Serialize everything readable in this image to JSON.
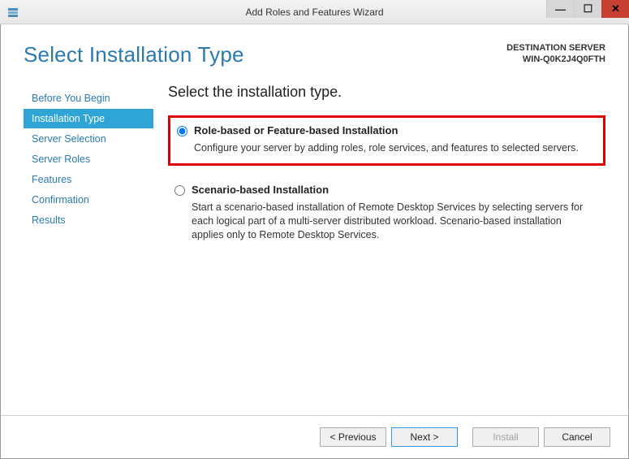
{
  "title": "Add Roles and Features Wizard",
  "destination": {
    "label": "DESTINATION SERVER",
    "name": "WIN-Q0K2J4Q0FTH"
  },
  "page_heading": "Select Installation Type",
  "main_heading": "Select the installation type.",
  "sidebar": {
    "items": [
      {
        "label": "Before You Begin"
      },
      {
        "label": "Installation Type"
      },
      {
        "label": "Server Selection"
      },
      {
        "label": "Server Roles"
      },
      {
        "label": "Features"
      },
      {
        "label": "Confirmation"
      },
      {
        "label": "Results"
      }
    ]
  },
  "options": {
    "role_based": {
      "label": "Role-based or Feature-based Installation",
      "desc": "Configure your server by adding roles, role services, and features to selected servers."
    },
    "scenario_based": {
      "label": "Scenario-based Installation",
      "desc": "Start a scenario-based installation of Remote Desktop Services by selecting servers for each logical part of a multi-server distributed workload. Scenario-based installation applies only to Remote Desktop Services."
    }
  },
  "footer": {
    "previous": "< Previous",
    "next": "Next >",
    "install": "Install",
    "cancel": "Cancel"
  }
}
